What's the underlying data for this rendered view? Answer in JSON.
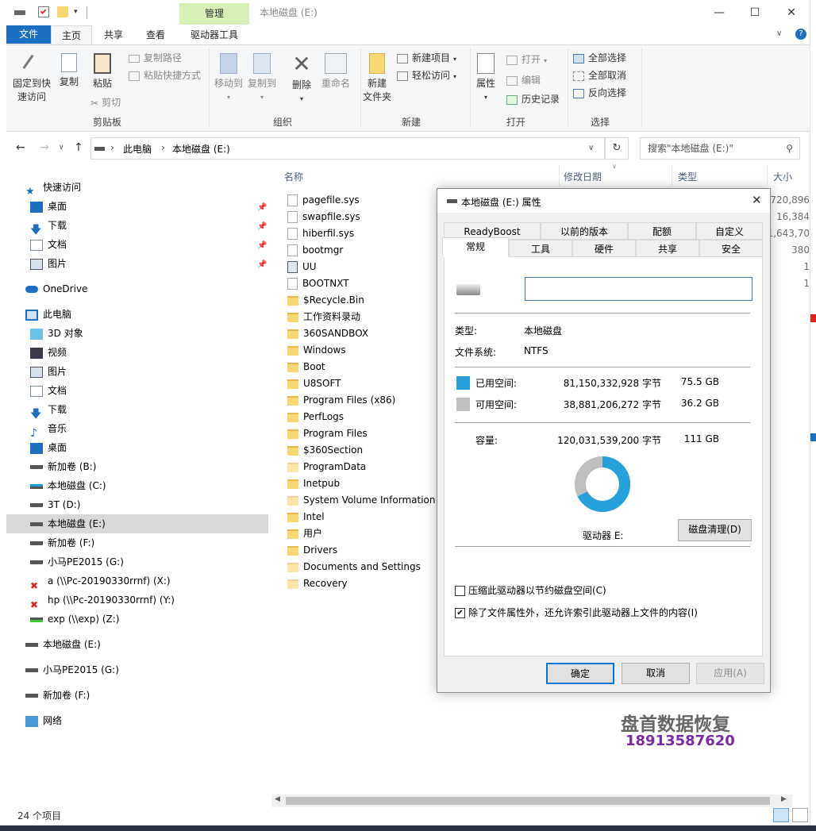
{
  "window": {
    "title": "本地磁盘 (E:)",
    "context_tab": "管理"
  },
  "ribbon_tabs": [
    "文件",
    "主页",
    "共享",
    "查看",
    "驱动器工具"
  ],
  "ribbon": {
    "pin_label_1": "固定到快",
    "pin_label_2": "速访问",
    "copy": "复制",
    "paste": "粘贴",
    "copy_path": "复制路径",
    "paste_shortcut": "粘贴快捷方式",
    "cut": "剪切",
    "clipboard_group": "剪贴板",
    "move_to": "移动到",
    "copy_to": "复制到",
    "delete": "删除",
    "rename": "重命名",
    "organize_group": "组织",
    "new_folder_1": "新建",
    "new_folder_2": "文件夹",
    "new_item": "新建项目",
    "easy_access": "轻松访问",
    "new_group": "新建",
    "properties": "属性",
    "open": "打开",
    "edit": "编辑",
    "history": "历史记录",
    "open_group": "打开",
    "select_all": "全部选择",
    "select_none": "全部取消",
    "invert_selection": "反向选择",
    "select_group": "选择"
  },
  "address": {
    "crumbs": [
      "此电脑",
      "本地磁盘 (E:)"
    ],
    "search_placeholder": "搜索\"本地磁盘 (E:)\""
  },
  "nav": {
    "quick_access": "快速访问",
    "quick_items": [
      "桌面",
      "下载",
      "文档",
      "图片"
    ],
    "onedrive": "OneDrive",
    "this_pc": "此电脑",
    "pc_items": [
      "3D 对象",
      "视频",
      "图片",
      "文档",
      "下载",
      "音乐",
      "桌面"
    ],
    "drives": [
      "新加卷 (B:)",
      "本地磁盘 (C:)",
      "3T (D:)",
      "本地磁盘 (E:)",
      "新加卷 (F:)",
      "小马PE2015 (G:)",
      "a (\\\\Pc-20190330rrnf) (X:)",
      "hp (\\\\Pc-20190330rrnf) (Y:)",
      "exp (\\\\exp) (Z:)"
    ],
    "extra_drives": [
      "本地磁盘 (E:)",
      "小马PE2015 (G:)",
      "新加卷 (F:)"
    ],
    "network": "网络"
  },
  "columns": {
    "name": "名称",
    "date": "修改日期",
    "type": "类型",
    "size": "大小"
  },
  "files": [
    "pagefile.sys",
    "swapfile.sys",
    "hiberfil.sys",
    "bootmgr",
    "UU",
    "BOOTNXT",
    "$Recycle.Bin",
    "工作资料录动",
    "360SANDBOX",
    "Windows",
    "Boot",
    "U8SOFT",
    "Program Files (x86)",
    "PerfLogs",
    "Program Files",
    "$360Section",
    "ProgramData",
    "Inetpub",
    "System Volume Information",
    "Intel",
    "用户",
    "Drivers",
    "Documents and Settings",
    "Recovery"
  ],
  "sizes": [
    "720,896",
    "16,384",
    "1,643,70",
    "380",
    "1",
    "1"
  ],
  "status": {
    "count": "24 个项目"
  },
  "dialog": {
    "title": "本地磁盘 (E:) 属性",
    "tabs_row1": [
      "ReadyBoost",
      "以前的版本",
      "配额",
      "自定义"
    ],
    "tabs_row2": [
      "常规",
      "工具",
      "硬件",
      "共享",
      "安全"
    ],
    "type_label": "类型:",
    "type_value": "本地磁盘",
    "fs_label": "文件系统:",
    "fs_value": "NTFS",
    "used_label": "已用空间:",
    "used_bytes": "81,150,332,928 字节",
    "used_gb": "75.5 GB",
    "free_label": "可用空间:",
    "free_bytes": "38,881,206,272 字节",
    "free_gb": "36.2 GB",
    "cap_label": "容量:",
    "cap_bytes": "120,031,539,200 字节",
    "cap_gb": "111 GB",
    "drive_label": "驱动器 E:",
    "cleanup": "磁盘清理(D)",
    "compress": "压缩此驱动器以节约磁盘空间(C)",
    "index": "除了文件属性外，还允许索引此驱动器上文件的内容(I)",
    "ok": "确定",
    "cancel": "取消",
    "apply": "应用(A)",
    "used_color": "#26a0da",
    "free_color": "#bfbfbf",
    "used_fraction": 0.676
  },
  "watermark": {
    "line1": "盘首数据恢复",
    "line2": "18913587620"
  }
}
